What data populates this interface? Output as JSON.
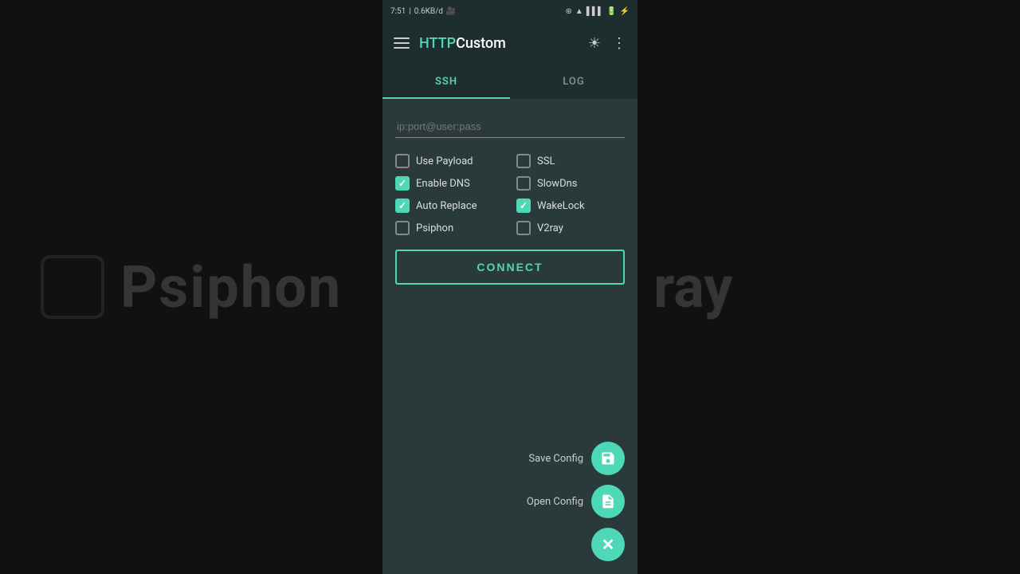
{
  "background": {
    "left_text": "Psiphon",
    "right_text": "ray"
  },
  "status_bar": {
    "time": "7:51",
    "data_speed": "0.6KB/d",
    "battery": "80"
  },
  "header": {
    "title_http": "HTTP",
    "title_custom": " Custom",
    "menu_icon": "≡",
    "theme_icon": "☀",
    "more_icon": "⋮"
  },
  "tabs": [
    {
      "label": "SSH",
      "active": true
    },
    {
      "label": "LOG",
      "active": false
    }
  ],
  "input": {
    "placeholder": "ip:port@user:pass",
    "value": ""
  },
  "checkboxes": [
    {
      "id": "use-payload",
      "label": "Use Payload",
      "checked": false
    },
    {
      "id": "ssl",
      "label": "SSL",
      "checked": false
    },
    {
      "id": "enable-dns",
      "label": "Enable DNS",
      "checked": true
    },
    {
      "id": "slow-dns",
      "label": "SlowDns",
      "checked": false
    },
    {
      "id": "auto-replace",
      "label": "Auto Replace",
      "checked": true
    },
    {
      "id": "wakelock",
      "label": "WakeLock",
      "checked": true
    },
    {
      "id": "psiphon",
      "label": "Psiphon",
      "checked": false
    },
    {
      "id": "v2ray",
      "label": "V2ray",
      "checked": false
    }
  ],
  "connect_button": {
    "label": "CONNECT"
  },
  "fab": {
    "save_label": "Save Config",
    "open_label": "Open Config",
    "save_icon": "💾",
    "open_icon": "📄",
    "close_icon": "✕"
  }
}
